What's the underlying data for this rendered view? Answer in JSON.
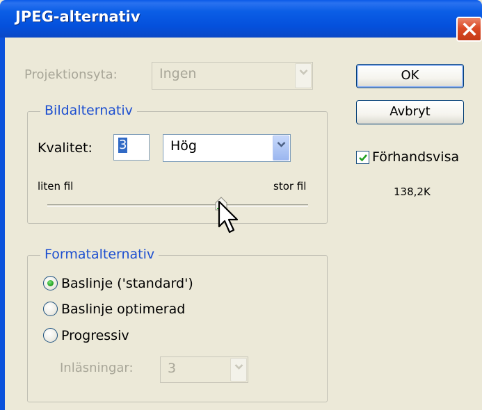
{
  "window": {
    "title": "JPEG-alternativ"
  },
  "projection": {
    "label": "Projektionsyta:",
    "value": "Ingen"
  },
  "image_options": {
    "title": "Bildalternativ",
    "quality_label": "Kvalitet:",
    "quality_value": "3",
    "quality_preset": "Hög",
    "small_label": "liten fil",
    "large_label": "stor fil",
    "slider_position": 0.72
  },
  "format_options": {
    "title": "Formatalternativ",
    "options": [
      {
        "label": "Baslinje ('standard')",
        "selected": true
      },
      {
        "label": "Baslinje optimerad",
        "selected": false
      },
      {
        "label": "Progressiv",
        "selected": false
      }
    ],
    "scans_label": "Inläsningar:",
    "scans_value": "3"
  },
  "buttons": {
    "ok": "OK",
    "cancel": "Avbryt"
  },
  "preview": {
    "label": "Förhandsvisa",
    "checked": true,
    "size": "138,2K"
  }
}
